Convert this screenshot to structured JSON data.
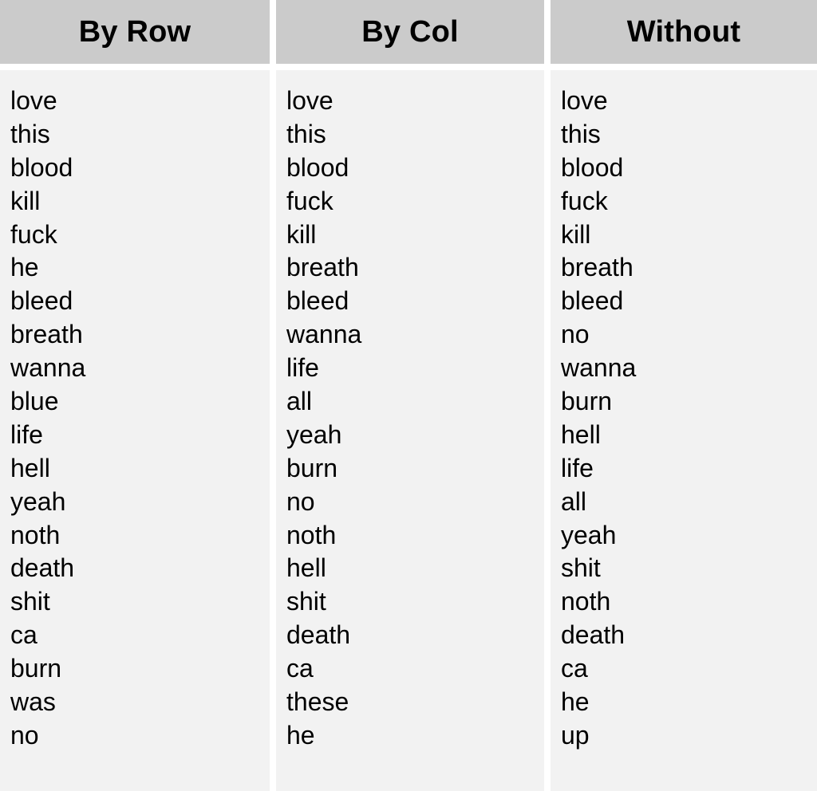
{
  "table": {
    "columns": [
      {
        "header": "By Row",
        "words": [
          "love",
          "this",
          "blood",
          "kill",
          "fuck",
          "he",
          "bleed",
          "breath",
          "wanna",
          "blue",
          "life",
          "hell",
          "yeah",
          "noth",
          "death",
          "shit",
          "ca",
          "burn",
          "was",
          "no"
        ]
      },
      {
        "header": "By Col",
        "words": [
          "love",
          "this",
          "blood",
          "fuck",
          "kill",
          "breath",
          "bleed",
          "wanna",
          "life",
          "all",
          "yeah",
          "burn",
          "no",
          "noth",
          "hell",
          "shit",
          "death",
          "ca",
          "these",
          "he"
        ]
      },
      {
        "header": "Without",
        "words": [
          "love",
          "this",
          "blood",
          "fuck",
          "kill",
          "breath",
          "bleed",
          "no",
          "wanna",
          "burn",
          "hell",
          "life",
          "all",
          "yeah",
          "shit",
          "noth",
          "death",
          "ca",
          "he",
          "up"
        ]
      }
    ]
  },
  "colors": {
    "header_bg": "#cbcbcb",
    "body_bg": "#f2f2f2",
    "text": "#000000"
  }
}
